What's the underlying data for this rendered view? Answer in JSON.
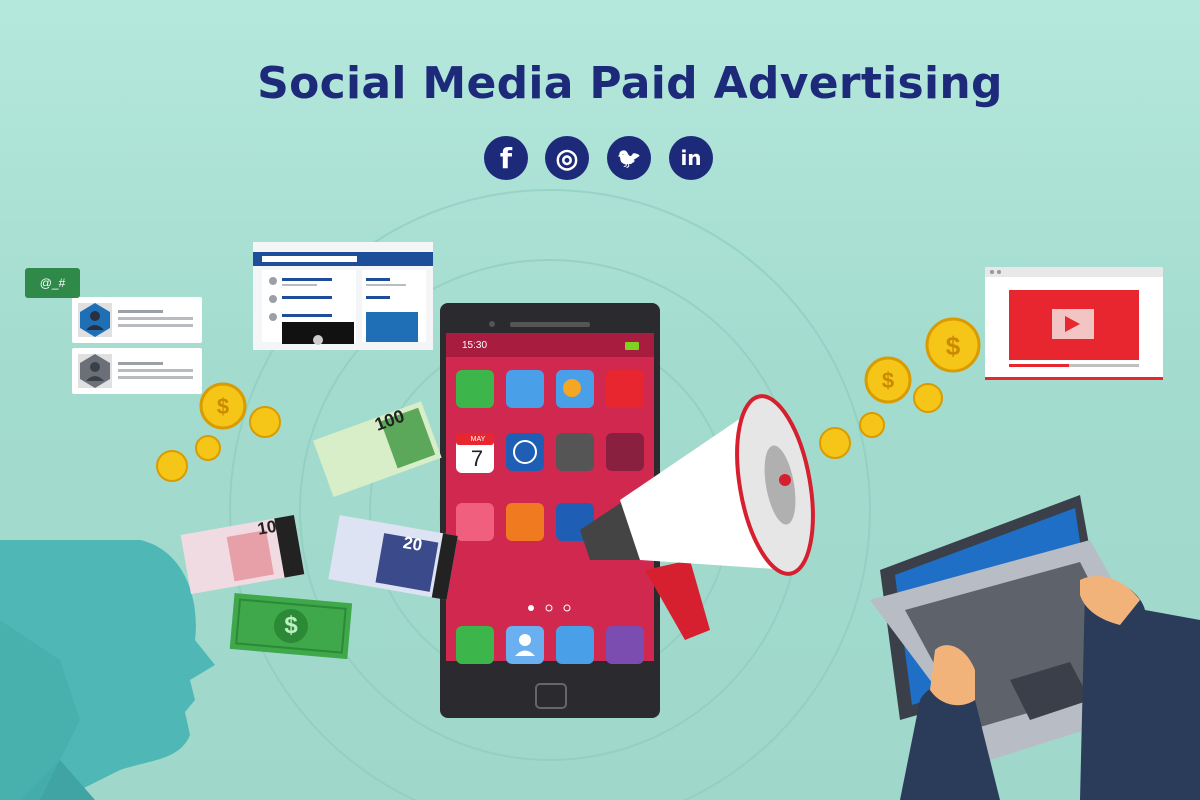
{
  "heading": "Social Media Paid Advertising",
  "social_icons": [
    {
      "name": "facebook-icon",
      "glyph": "f"
    },
    {
      "name": "instagram-icon",
      "glyph": "◎"
    },
    {
      "name": "twitter-icon",
      "glyph": "🐦"
    },
    {
      "name": "linkedin-icon",
      "glyph": "in"
    }
  ],
  "phone": {
    "status_time": "15:30",
    "calendar_month": "MAY",
    "calendar_day": "7"
  },
  "chat_tag": "@_#",
  "bills": {
    "hundred": "100",
    "ten": "10",
    "twenty": "20"
  },
  "currency_symbol": "$",
  "colors": {
    "heading": "#1d2a7a",
    "background": "#a6e0d3",
    "phone_screen": "#d0284f"
  }
}
